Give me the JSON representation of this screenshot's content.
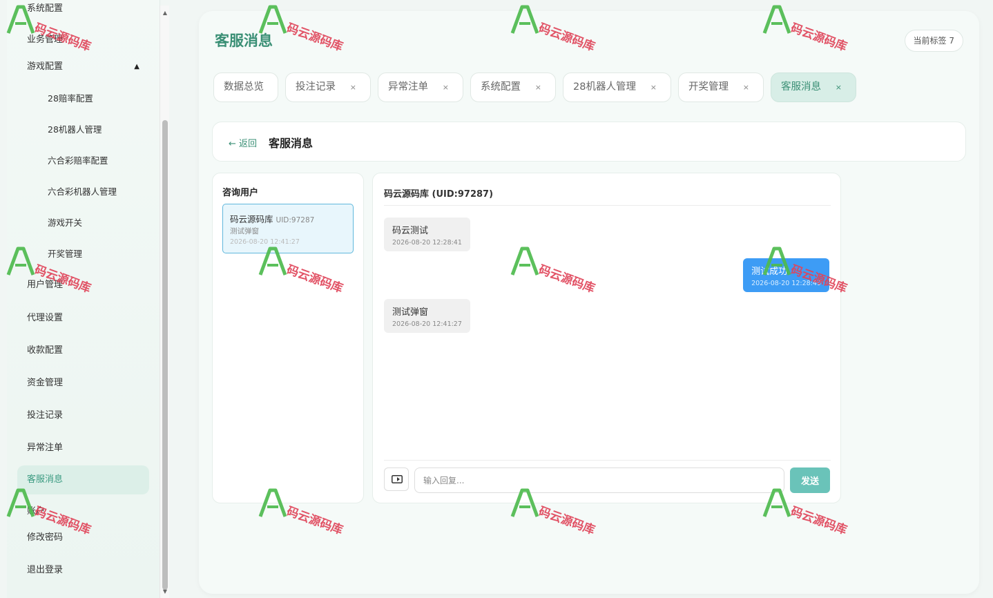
{
  "sidebar": {
    "items": [
      {
        "label": "系统配置",
        "level": "top"
      },
      {
        "label": "业务管理",
        "level": "top"
      },
      {
        "label": "游戏配置",
        "level": "group",
        "expanded": true
      },
      {
        "label": "28赔率配置",
        "level": "sub"
      },
      {
        "label": "28机器人管理",
        "level": "sub"
      },
      {
        "label": "六合彩赔率配置",
        "level": "sub"
      },
      {
        "label": "六合彩机器人管理",
        "level": "sub"
      },
      {
        "label": "游戏开关",
        "level": "sub"
      },
      {
        "label": "开奖管理",
        "level": "sub"
      },
      {
        "label": "用户管理",
        "level": "top"
      },
      {
        "label": "代理设置",
        "level": "top"
      },
      {
        "label": "收款配置",
        "level": "top"
      },
      {
        "label": "资金管理",
        "level": "top"
      },
      {
        "label": "投注记录",
        "level": "top"
      },
      {
        "label": "异常注单",
        "level": "top"
      },
      {
        "label": "客服消息",
        "level": "top",
        "active": true
      },
      {
        "label": "账户",
        "level": "top"
      },
      {
        "label": "修改密码",
        "level": "top"
      },
      {
        "label": "退出登录",
        "level": "top"
      }
    ],
    "caret": "▲"
  },
  "main": {
    "title": "客服消息",
    "tag_count": "当前标签 7",
    "tabs": [
      {
        "label": "数据总览",
        "closable": false
      },
      {
        "label": "投注记录",
        "closable": true
      },
      {
        "label": "异常注单",
        "closable": true
      },
      {
        "label": "系统配置",
        "closable": true
      },
      {
        "label": "28机器人管理",
        "closable": true
      },
      {
        "label": "开奖管理",
        "closable": true
      },
      {
        "label": "客服消息",
        "closable": true,
        "active": true
      }
    ],
    "close_glyph": "×",
    "back_label": "← 返回",
    "header_title": "客服消息"
  },
  "users": {
    "title": "咨询用户",
    "list": [
      {
        "name": "码云源码库",
        "uid": "UID:97287",
        "last_message": "测试弹窗",
        "time": "2026-08-20 12:41:27"
      }
    ]
  },
  "chat": {
    "title": "码云源码库 (UID:97287)",
    "messages": [
      {
        "text": "码云测试",
        "time": "2026-08-20 12:28:41",
        "direction": "in"
      },
      {
        "text": "测试成功",
        "time": "2026-08-20 12:28:49",
        "direction": "out"
      },
      {
        "text": "测试弹窗",
        "time": "2026-08-20 12:41:27",
        "direction": "in"
      }
    ],
    "input_placeholder": "输入回复...",
    "send_label": "发送"
  },
  "watermark": {
    "text": "码云源码库"
  },
  "colors": {
    "accent": "#3a8f75",
    "active_tab_bg": "#d8eee7",
    "outgoing_bubble": "#3d9cf5",
    "send_button": "#6ac3b9",
    "selected_user_border": "#5fb7dc",
    "watermark": "#e0455a"
  }
}
